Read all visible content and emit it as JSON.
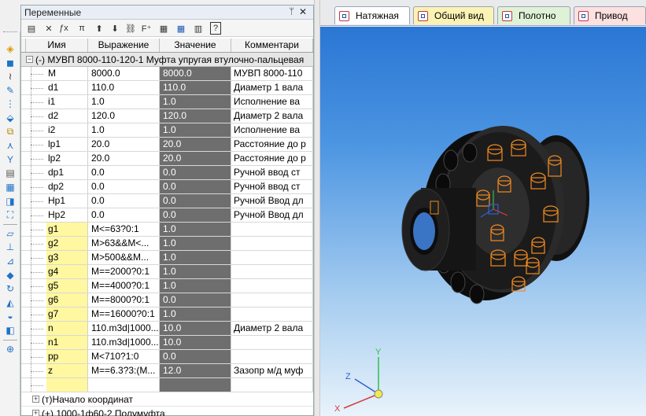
{
  "panel": {
    "title": "Переменные",
    "pin_glyph": "ᛘ",
    "close_glyph": "✕"
  },
  "columns": {
    "name": "Имя",
    "expression": "Выражение",
    "value": "Значение",
    "comment": "Комментари"
  },
  "group": {
    "expander": "−",
    "label": "(-) МУВП 8000-110-120-1 Муфта упругая втулочно-пальцевая"
  },
  "variables": [
    {
      "name": "M",
      "expr": "8000.0",
      "val": "8000.0",
      "comment": "МУВП 8000-110",
      "yellow": false
    },
    {
      "name": "d1",
      "expr": "110.0",
      "val": "110.0",
      "comment": "Диаметр 1 вала",
      "yellow": false
    },
    {
      "name": "i1",
      "expr": "1.0",
      "val": "1.0",
      "comment": "Исполнение ва",
      "yellow": false
    },
    {
      "name": "d2",
      "expr": "120.0",
      "val": "120.0",
      "comment": "Диаметр 2 вала",
      "yellow": false
    },
    {
      "name": "i2",
      "expr": "1.0",
      "val": "1.0",
      "comment": "Исполнение ва",
      "yellow": false
    },
    {
      "name": "lp1",
      "expr": "20.0",
      "val": "20.0",
      "comment": "Расстояние до р",
      "yellow": false
    },
    {
      "name": "lp2",
      "expr": "20.0",
      "val": "20.0",
      "comment": "Расстояние до р",
      "yellow": false
    },
    {
      "name": "dp1",
      "expr": "0.0",
      "val": "0.0",
      "comment": "Ручной ввод ст",
      "yellow": false
    },
    {
      "name": "dp2",
      "expr": "0.0",
      "val": "0.0",
      "comment": "Ручной ввод ст",
      "yellow": false
    },
    {
      "name": "Hp1",
      "expr": "0.0",
      "val": "0.0",
      "comment": "Ручной Ввод дл",
      "yellow": false
    },
    {
      "name": "Hp2",
      "expr": "0.0",
      "val": "0.0",
      "comment": "Ручной Ввод дл",
      "yellow": false
    },
    {
      "name": "g1",
      "expr": "M<=63?0:1",
      "val": "1.0",
      "comment": "",
      "yellow": true
    },
    {
      "name": "g2",
      "expr": "M>63&&M<...",
      "val": "1.0",
      "comment": "",
      "yellow": true
    },
    {
      "name": "g3",
      "expr": "M>500&&M...",
      "val": "1.0",
      "comment": "",
      "yellow": true
    },
    {
      "name": "g4",
      "expr": "M==2000?0:1",
      "val": "1.0",
      "comment": "",
      "yellow": true
    },
    {
      "name": "g5",
      "expr": "M==4000?0:1",
      "val": "1.0",
      "comment": "",
      "yellow": true
    },
    {
      "name": "g6",
      "expr": "M==8000?0:1",
      "val": "0.0",
      "comment": "",
      "yellow": true
    },
    {
      "name": "g7",
      "expr": "M==16000?0:1",
      "val": "1.0",
      "comment": "",
      "yellow": true
    },
    {
      "name": "n",
      "expr": "110.m3d|1000...",
      "val": "10.0",
      "comment": "Диаметр 2 вала",
      "yellow": true
    },
    {
      "name": "n1",
      "expr": "110.m3d|1000...",
      "val": "10.0",
      "comment": "",
      "yellow": true
    },
    {
      "name": "pp",
      "expr": "M<710?1:0",
      "val": "0.0",
      "comment": "",
      "yellow": true
    },
    {
      "name": "z",
      "expr": "M==6.3?3:(M...",
      "val": "12.0",
      "comment": "Зазопр м/д муф",
      "yellow": true
    },
    {
      "name": "",
      "expr": "",
      "val": "",
      "comment": "",
      "yellow": true
    }
  ],
  "subgroups": [
    {
      "expander": "+",
      "label": "(т)Начало координат"
    },
    {
      "expander": "+",
      "label": "(+) 1000-1ф60-2 Полумуфта"
    }
  ],
  "tabs": [
    {
      "label": "Натяжная",
      "bg": "#ffffff"
    },
    {
      "label": "Общий вид",
      "bg": "#fbf3b4"
    },
    {
      "label": "Полотно",
      "bg": "#dff2d6"
    },
    {
      "label": "Привод",
      "bg": "#fde0e0"
    }
  ],
  "axes": {
    "x": "X",
    "y": "Y",
    "z": "Z"
  },
  "icons": {
    "toolbar": [
      "variables-icon",
      "delete-icon",
      "fx-icon",
      "pi-icon",
      "up-icon",
      "down-icon",
      "link-icon",
      "fx-sub-icon",
      "doc-icon",
      "table-icon",
      "table2-icon",
      "help-icon"
    ],
    "left": [
      "parts-icon",
      "solid-icon",
      "spring-icon",
      "edit-icon",
      "array-icon",
      "mirror-icon",
      "pin-icon",
      "measure-icon",
      "filter-icon",
      "sheet-icon",
      "spec-icon",
      "report-icon",
      "fastener-icon",
      "plane-icon",
      "sketch-icon",
      "extrude-icon",
      "rib-icon",
      "rotate-icon",
      "loft-icon",
      "base-icon",
      "layer-icon",
      "search-icon"
    ]
  },
  "colors": {
    "yellow_cell": "#fff8a0",
    "value_cell": "#6e6e6e",
    "viewport_top": "#2a76d4",
    "viewport_bottom": "#e9f3fb",
    "model_body": "#1a1a1a",
    "pins": "#f28a1e"
  }
}
